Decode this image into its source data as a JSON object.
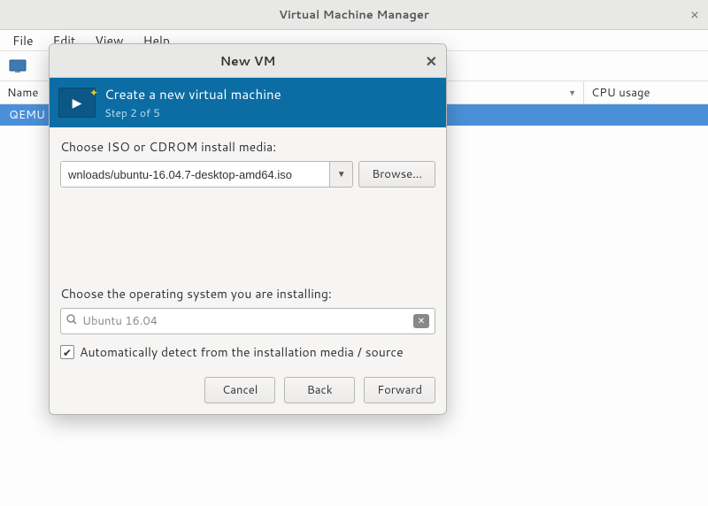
{
  "window": {
    "title": "Virtual Machine Manager"
  },
  "menu": {
    "file": "File",
    "edit": "Edit",
    "view": "View",
    "help": "Help"
  },
  "list": {
    "col_name": "Name",
    "col_cpu": "CPU usage",
    "row0": "QEMU"
  },
  "dialog": {
    "title": "New VM",
    "header_title": "Create a new virtual machine",
    "header_step": "Step 2 of 5",
    "media_label": "Choose ISO or CDROM install media:",
    "media_value": "wnloads/ubuntu-16.04.7-desktop-amd64.iso",
    "browse": "Browse...",
    "os_label": "Choose the operating system you are installing:",
    "os_value": "Ubuntu 16.04",
    "autodetect": "Automatically detect from the installation media / source",
    "cancel": "Cancel",
    "back": "Back",
    "forward": "Forward"
  }
}
